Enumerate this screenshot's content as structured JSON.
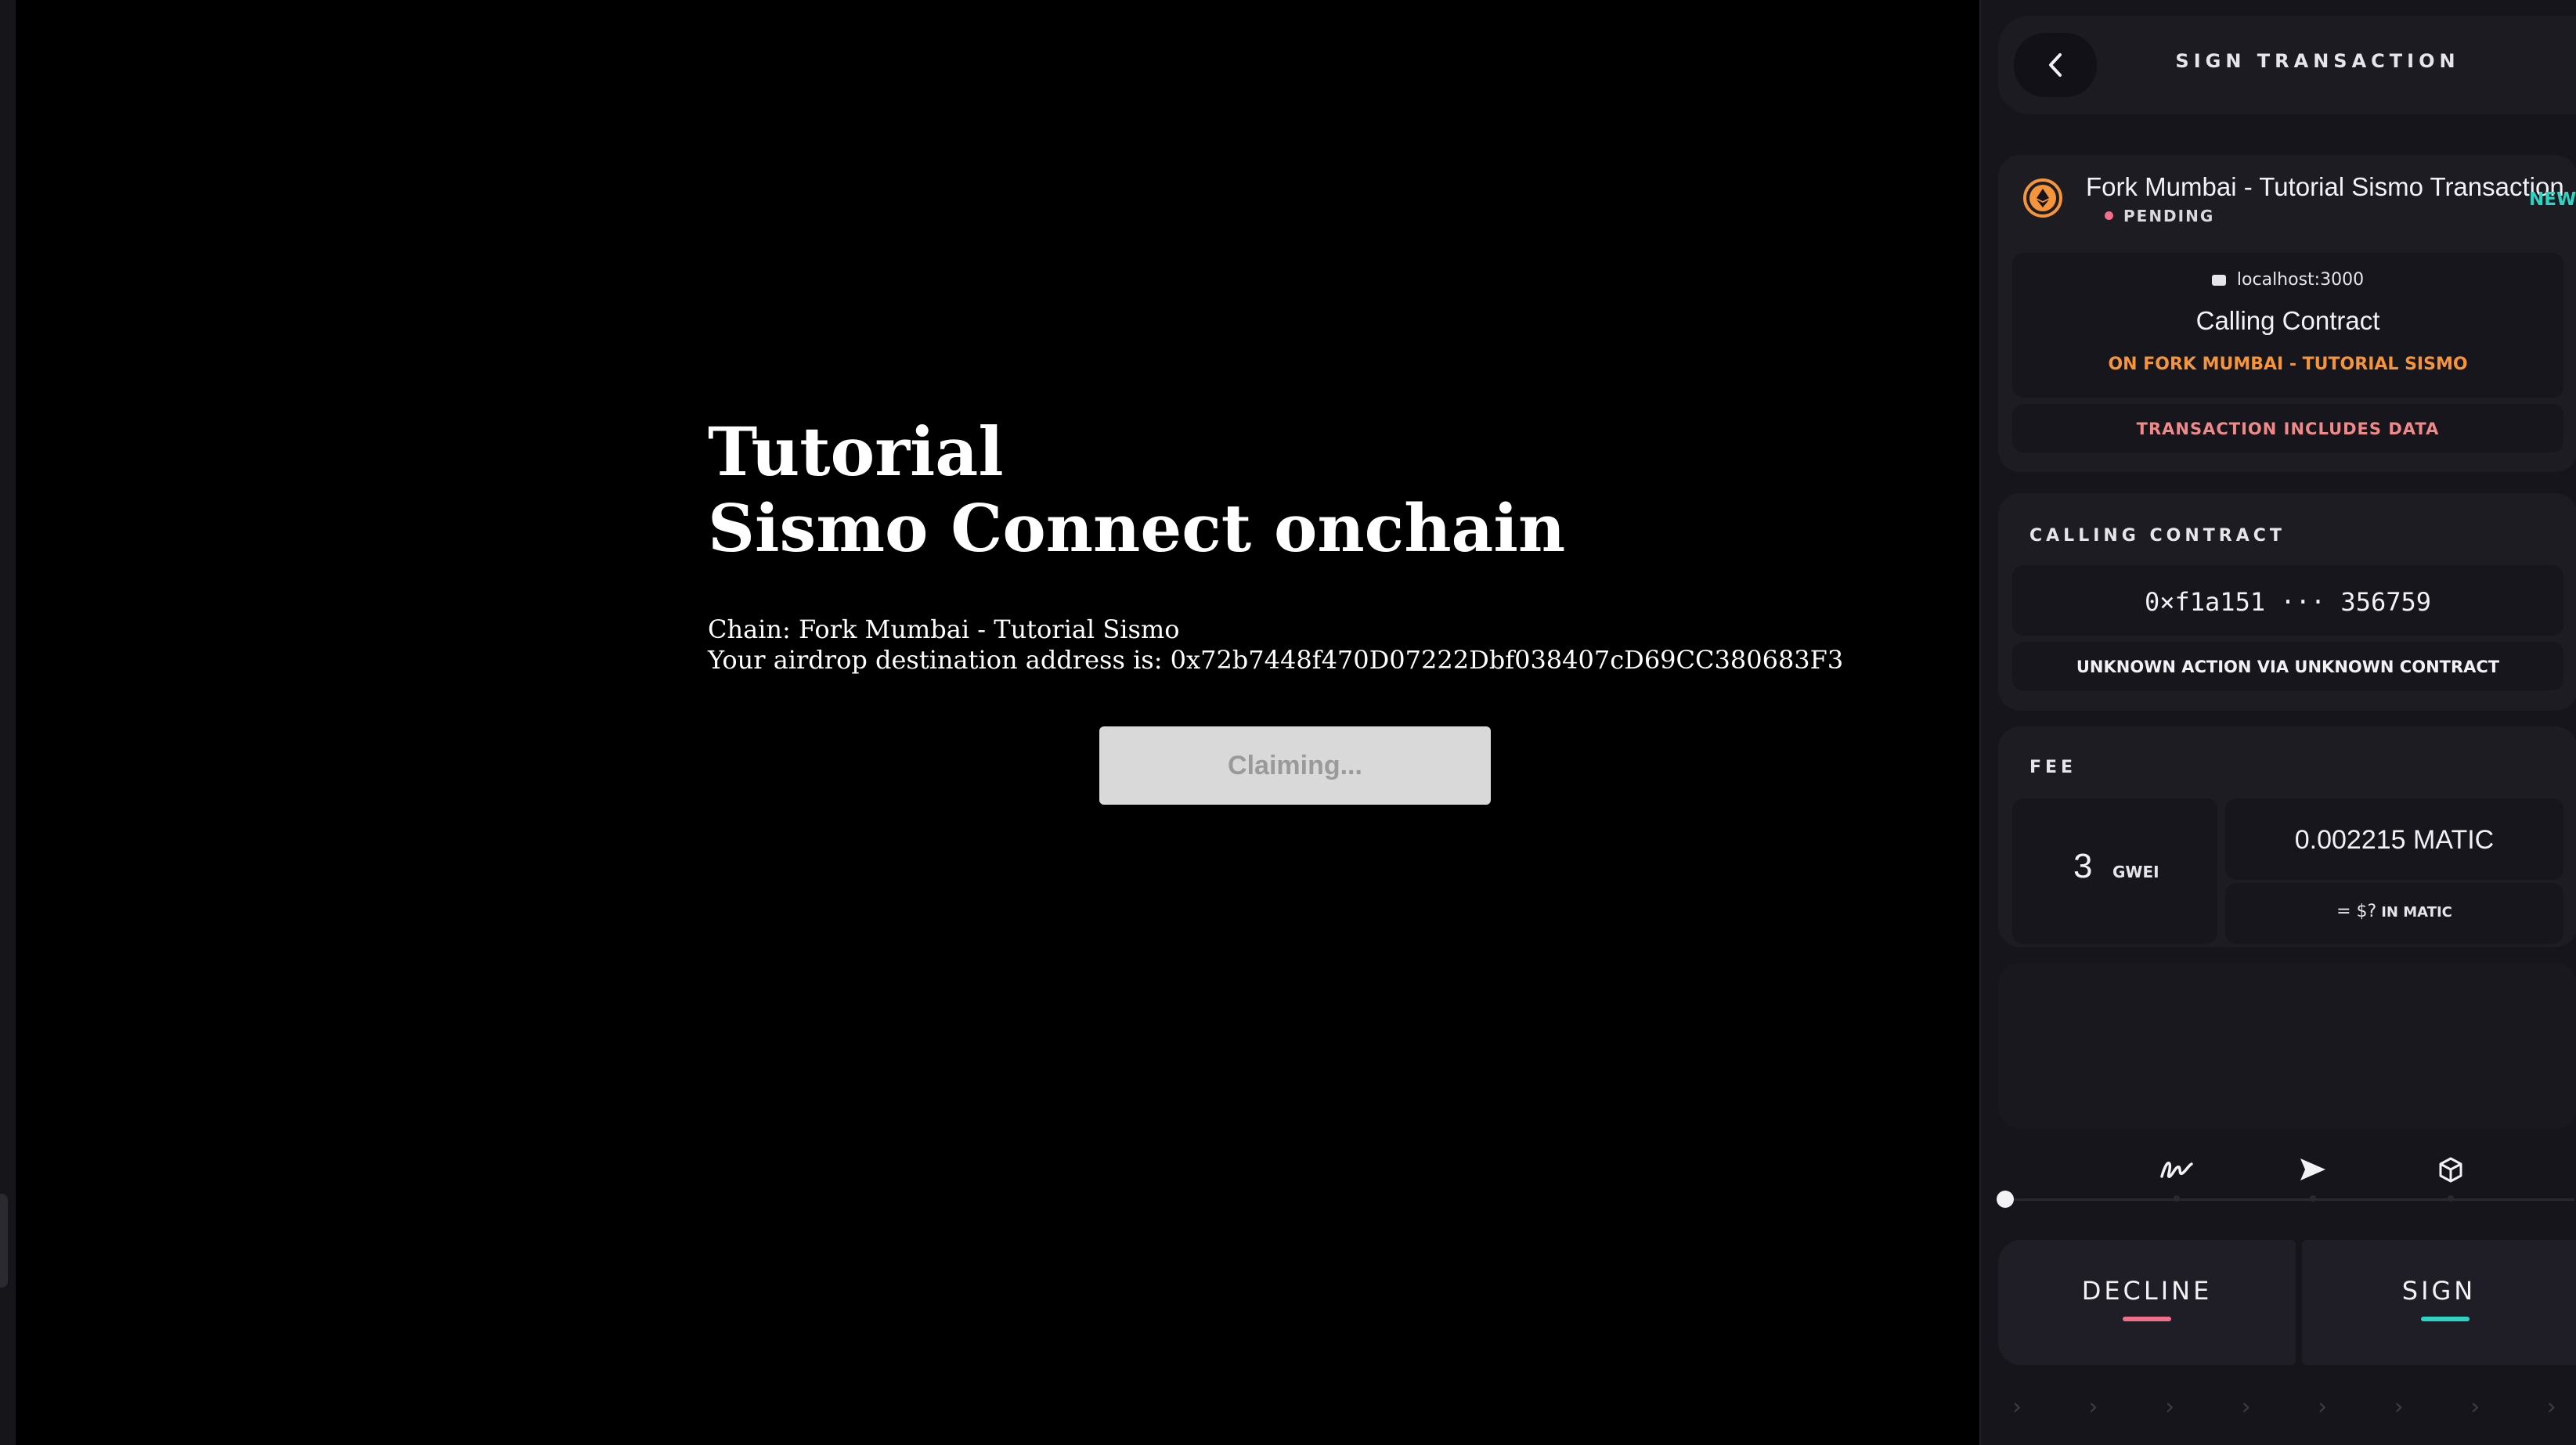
{
  "dapp": {
    "title": "Tutorial",
    "subtitle": "Sismo Connect onchain",
    "chain_line": "Chain: Fork Mumbai - Tutorial Sismo",
    "address_line": "Your airdrop destination address is: 0x72b7448f470D07222Dbf038407cD69CC380683F3",
    "claim_button": "Claiming..."
  },
  "wallet": {
    "header_title": "SIGN TRANSACTION",
    "transaction": {
      "name": "Fork Mumbai - Tutorial Sismo Transaction",
      "badge": "NEW",
      "status": "PENDING",
      "origin": "localhost:3000",
      "action_title": "Calling Contract",
      "network_line": "ON FORK MUMBAI - TUTORIAL SISMO",
      "includes_data": "TRANSACTION INCLUDES DATA"
    },
    "contract": {
      "section_label": "CALLING CONTRACT",
      "address": "0×f1a151 ··· 356759",
      "action": "UNKNOWN ACTION VIA UNKNOWN CONTRACT"
    },
    "fee": {
      "section_label": "FEE",
      "gwei_value": "3",
      "gwei_unit": "GWEI",
      "matic_value": "0.002215 MATIC",
      "usd_value": "= $?",
      "usd_unit": "IN MATIC"
    },
    "buttons": {
      "decline": "DECLINE",
      "sign": "SIGN"
    },
    "colors": {
      "accent_orange": "#f5943b",
      "accent_teal": "#2dd4c4",
      "accent_pink": "#f06f8a"
    },
    "step_icons": [
      "signature-icon",
      "send-icon",
      "cube-icon"
    ]
  }
}
